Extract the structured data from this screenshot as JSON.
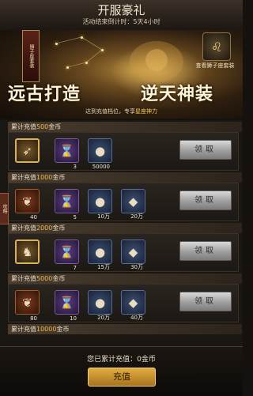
{
  "header": {
    "title": "开服豪礼",
    "subtitle": "活动结束倒计时：5天4小时"
  },
  "banner": {
    "ribbon": "狮子座套装",
    "set_button_label": "查看狮子座套装",
    "slogan_left": "远古打造",
    "slogan_right": "逆天神装",
    "note_prefix": "达到充值档位，专享",
    "note_highlight": "星座神力"
  },
  "side_tab": "攻略",
  "tiers": [
    {
      "prefix": "累计充值",
      "amount": "500",
      "suffix": "金币",
      "claim": "领取",
      "items": [
        {
          "icon": "spear-icon",
          "count": ""
        },
        {
          "icon": "hourglass-icon",
          "count": "3"
        },
        {
          "icon": "silver-orb-icon",
          "count": "50000"
        }
      ]
    },
    {
      "prefix": "累计充值",
      "amount": "1000",
      "suffix": "金币",
      "claim": "领取",
      "items": [
        {
          "icon": "feather-icon",
          "count": "40"
        },
        {
          "icon": "hourglass-icon",
          "count": "5"
        },
        {
          "icon": "silver-orb-icon",
          "count": "10万"
        },
        {
          "icon": "ore-icon",
          "count": "20万"
        }
      ]
    },
    {
      "prefix": "累计充值",
      "amount": "2000",
      "suffix": "金币",
      "claim": "领取",
      "items": [
        {
          "icon": "horse-icon",
          "count": ""
        },
        {
          "icon": "hourglass-icon",
          "count": "7"
        },
        {
          "icon": "silver-orb-icon",
          "count": "15万"
        },
        {
          "icon": "ore-icon",
          "count": "30万"
        }
      ]
    },
    {
      "prefix": "累计充值",
      "amount": "5000",
      "suffix": "金币",
      "claim": "领取",
      "items": [
        {
          "icon": "feather-icon",
          "count": "80"
        },
        {
          "icon": "hourglass-icon",
          "count": "10"
        },
        {
          "icon": "silver-orb-icon",
          "count": "20万"
        },
        {
          "icon": "ore-icon",
          "count": "40万"
        }
      ]
    },
    {
      "prefix": "累计充值",
      "amount": "10000",
      "suffix": "金币",
      "claim": "",
      "items": []
    }
  ],
  "footer": {
    "total_text": "您已累计充值：0金币",
    "recharge_label": "充值"
  },
  "colors": {
    "amount": "#f2b549",
    "gold_frame": "#d8b25a",
    "claim_button": "#9e9e9e",
    "recharge_button": "#d99f36"
  }
}
